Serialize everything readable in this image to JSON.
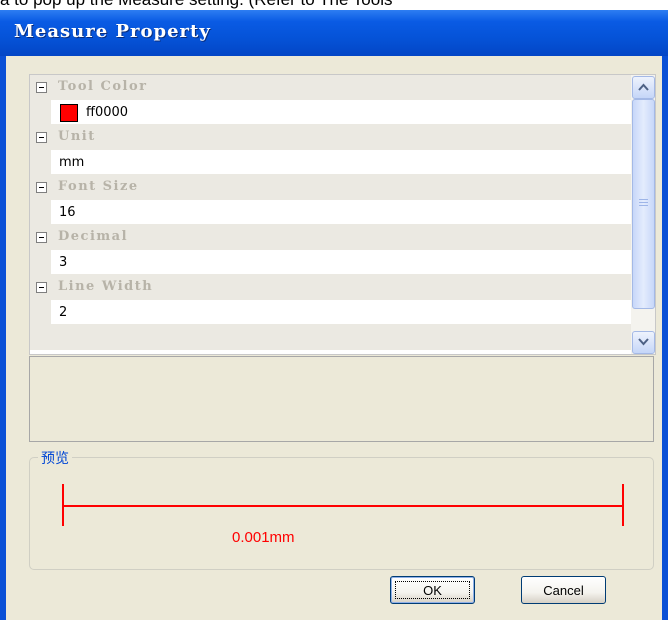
{
  "top_strip_text": "a to pop up the Measure setting. (Refer to The Tools",
  "window": {
    "title": "Measure Property"
  },
  "property_grid": {
    "categories": [
      {
        "label": "Tool Color",
        "value": "ff0000",
        "swatch_color": "#ff0000"
      },
      {
        "label": "Unit",
        "value": "mm"
      },
      {
        "label": "Font Size",
        "value": "16"
      },
      {
        "label": "Decimal",
        "value": "3"
      },
      {
        "label": "Line Width",
        "value": "2"
      }
    ]
  },
  "preview": {
    "legend": "预览",
    "label": "0.001mm",
    "line_color": "#ff0000"
  },
  "buttons": {
    "ok": "OK",
    "cancel": "Cancel"
  },
  "colors": {
    "titlebar": "#0a5be4",
    "client_bg": "#ece9d8",
    "legend": "#0046d5"
  },
  "icons": {
    "expander": "minus-box-icon",
    "scroll_up": "chevron-up-icon",
    "scroll_down": "chevron-down-icon"
  }
}
